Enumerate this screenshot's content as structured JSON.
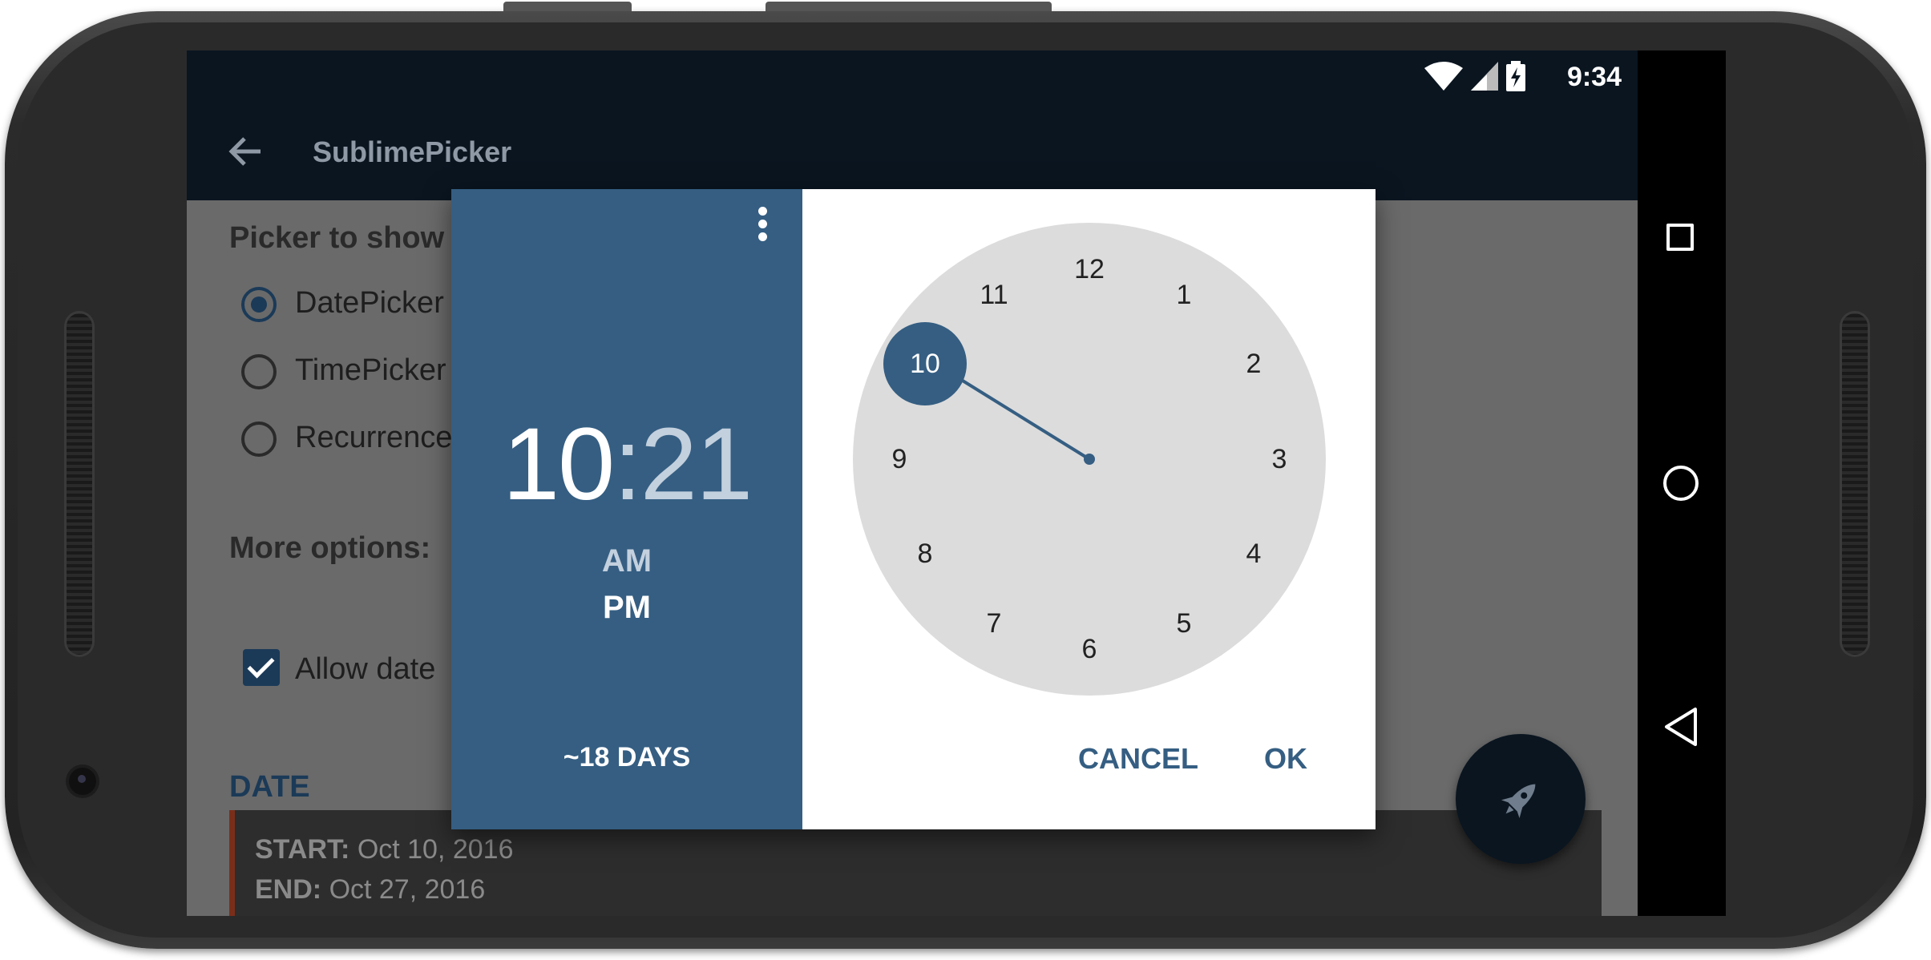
{
  "status_bar": {
    "time": "9:34"
  },
  "toolbar": {
    "title": "SublimePicker",
    "back_icon": "arrow-left-icon"
  },
  "settings": {
    "picker_heading": "Picker to show",
    "options": [
      {
        "label": "DatePicker",
        "selected": true
      },
      {
        "label": "TimePicker",
        "selected": false
      },
      {
        "label": "Recurrence",
        "selected": false
      }
    ],
    "more_heading": "More options:",
    "allow_label": "Allow date",
    "allow_checked": true
  },
  "date_section": {
    "heading": "DATE",
    "start_label": "START:",
    "start_value": "Oct 10, 2016",
    "end_label": "END:",
    "end_value": "Oct 27, 2016"
  },
  "fab": {
    "icon": "rocket-icon"
  },
  "dialog": {
    "hours": "10",
    "separator": ":",
    "minutes": "21",
    "am_label": "AM",
    "pm_label": "PM",
    "selected_period": "PM",
    "days_label": "~18 DAYS",
    "clock_numbers": [
      "12",
      "1",
      "2",
      "3",
      "4",
      "5",
      "6",
      "7",
      "8",
      "9",
      "10",
      "11"
    ],
    "selected_hour": "10",
    "cancel_label": "CANCEL",
    "ok_label": "OK",
    "accent_color": "#355e82"
  },
  "navbar": {
    "square_icon": "recents-icon",
    "circle_icon": "home-icon",
    "triangle_icon": "back-icon"
  }
}
